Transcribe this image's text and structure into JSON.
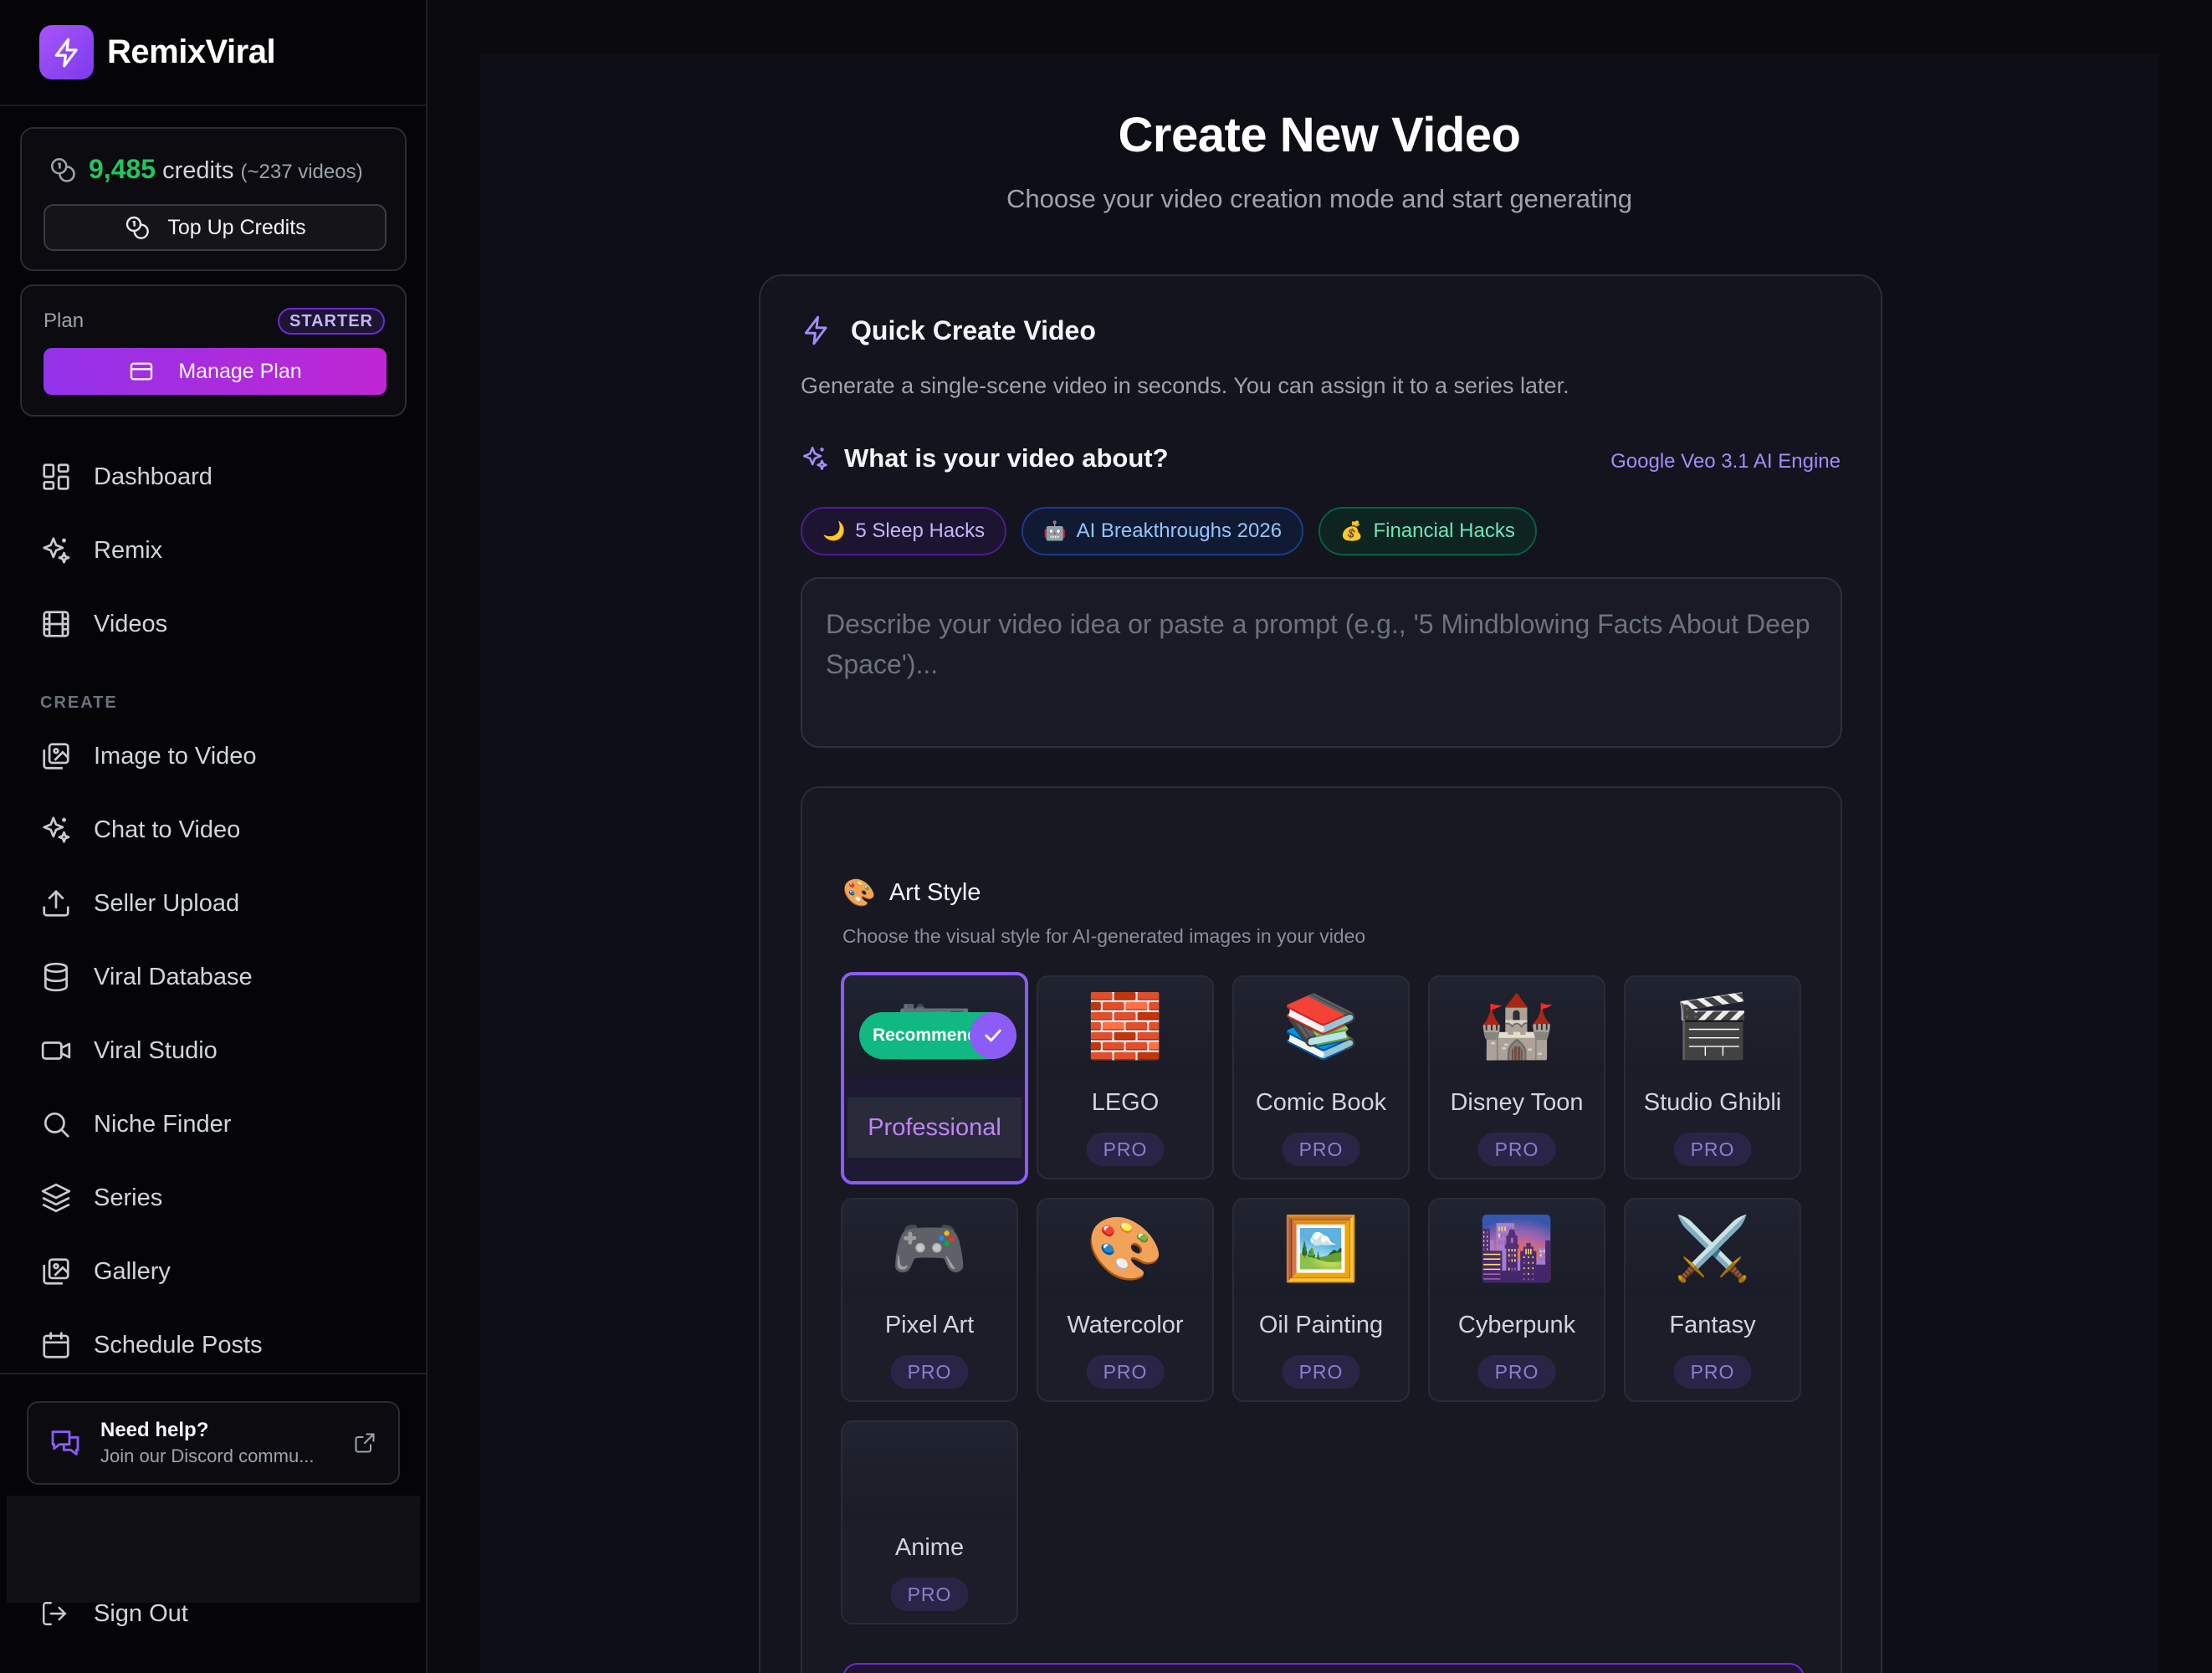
{
  "brand": {
    "name": "RemixViral"
  },
  "credits": {
    "amount": "9,485",
    "word": "credits",
    "estimate": "(~237 videos)",
    "topup_label": "Top Up Credits"
  },
  "plan": {
    "label": "Plan",
    "badge": "STARTER",
    "manage_label": "Manage Plan"
  },
  "nav": {
    "main": [
      {
        "label": "Dashboard",
        "icon": "dashboard-icon"
      },
      {
        "label": "Remix",
        "icon": "sparkles-icon"
      },
      {
        "label": "Videos",
        "icon": "film-icon"
      }
    ],
    "section_label": "CREATE",
    "create": [
      {
        "label": "Image to Video",
        "icon": "image-icon"
      },
      {
        "label": "Chat to Video",
        "icon": "sparkles-icon"
      },
      {
        "label": "Seller Upload",
        "icon": "upload-icon"
      },
      {
        "label": "Viral Database",
        "icon": "database-icon"
      },
      {
        "label": "Viral Studio",
        "icon": "video-camera-icon"
      },
      {
        "label": "Niche Finder",
        "icon": "search-icon"
      },
      {
        "label": "Series",
        "icon": "layers-icon"
      },
      {
        "label": "Gallery",
        "icon": "image-icon"
      },
      {
        "label": "Schedule Posts",
        "icon": "calendar-icon"
      }
    ]
  },
  "help": {
    "title": "Need help?",
    "subtitle": "Join our Discord commu..."
  },
  "signout": {
    "label": "Sign Out"
  },
  "page": {
    "title": "Create New Video",
    "subtitle": "Choose your video creation mode and start generating"
  },
  "quick_create": {
    "title": "Quick Create Video",
    "description": "Generate a single-scene video in seconds. You can assign it to a series later.",
    "about_title": "What is your video about?",
    "engine": "Google Veo 3.1 AI Engine",
    "chips": [
      {
        "emoji": "🌙",
        "label": "5 Sleep Hacks"
      },
      {
        "emoji": "🤖",
        "label": "AI Breakthroughs 2026"
      },
      {
        "emoji": "💰",
        "label": "Financial Hacks"
      }
    ],
    "prompt_value": "",
    "prompt_placeholder": "Describe your video idea or paste a prompt (e.g., '5 Mindblowing Facts About Deep Space')..."
  },
  "art_style": {
    "title": "Art Style",
    "emoji": "🎨",
    "description": "Choose the visual style for AI-generated images in your video",
    "recommended_label": "Recommended",
    "pro_label": "PRO",
    "selected": "Professional",
    "styles": [
      {
        "name": "Professional",
        "emoji": "📷",
        "pro": false
      },
      {
        "name": "LEGO",
        "emoji": "🧱",
        "pro": true
      },
      {
        "name": "Comic Book",
        "emoji": "📚",
        "pro": true
      },
      {
        "name": "Disney Toon",
        "emoji": "🏰",
        "pro": true
      },
      {
        "name": "Studio Ghibli",
        "emoji": "🎬",
        "pro": true
      },
      {
        "name": "Pixel Art",
        "emoji": "🎮",
        "pro": true
      },
      {
        "name": "Watercolor",
        "emoji": "🎨",
        "pro": true
      },
      {
        "name": "Oil Painting",
        "emoji": "🖼️",
        "pro": true
      },
      {
        "name": "Cyberpunk",
        "emoji": "🌆",
        "pro": true
      },
      {
        "name": "Fantasy",
        "emoji": "⚔️",
        "pro": true
      },
      {
        "name": "Anime",
        "emoji": "",
        "pro": true
      }
    ]
  },
  "colors": {
    "accent": "#8b5cf6",
    "credits_green": "#22c55e",
    "recommended_green": "#10b981",
    "background": "#0d0e16"
  }
}
